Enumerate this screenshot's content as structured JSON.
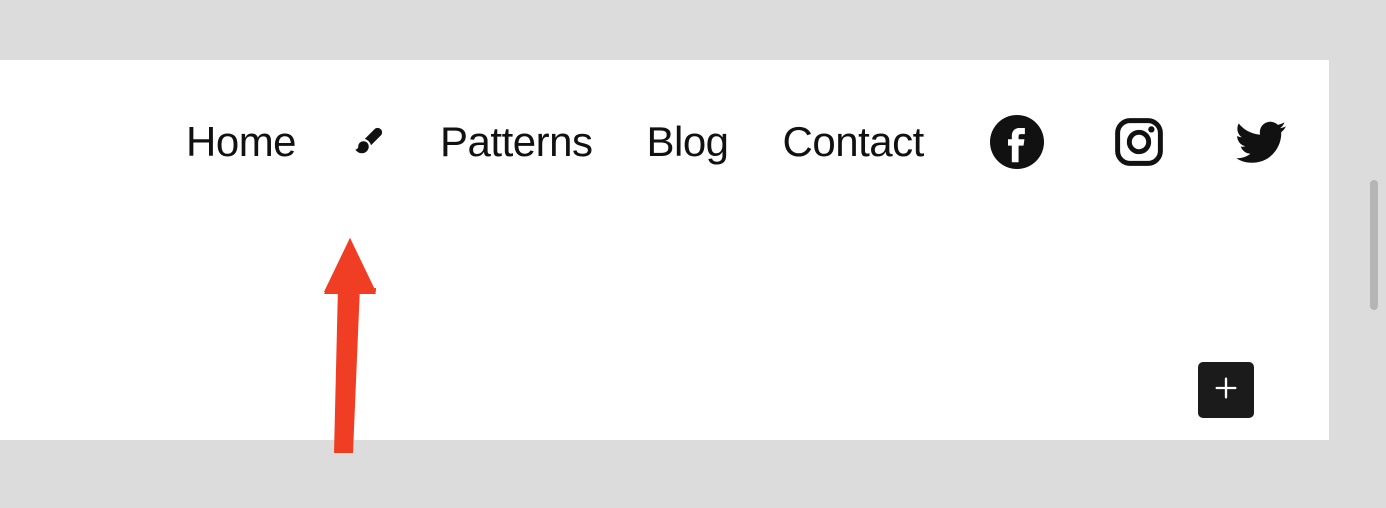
{
  "nav": {
    "items": [
      {
        "label": "Home"
      },
      {
        "label": "Patterns"
      },
      {
        "label": "Blog"
      },
      {
        "label": "Contact"
      }
    ]
  },
  "social": {
    "items": [
      {
        "name": "facebook"
      },
      {
        "name": "instagram"
      },
      {
        "name": "twitter"
      }
    ]
  },
  "colors": {
    "arrow": "#ef3e23",
    "bg": "#dcdcdc",
    "canvas": "#ffffff",
    "add_btn": "#1b1b1b"
  }
}
